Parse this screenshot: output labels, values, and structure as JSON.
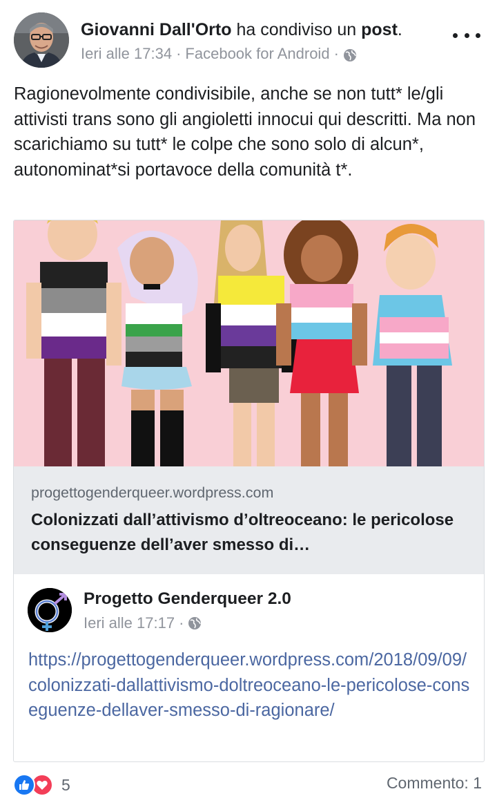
{
  "post": {
    "author": "Giovanni Dall'Orto",
    "action_text": "ha condiviso un",
    "action_object": "post",
    "action_suffix": ".",
    "timestamp": "Ieri alle 17:34",
    "source": "Facebook for Android",
    "separator": "·",
    "body": "Ragionevolmente condivisibile, anche se non tutt* le/gli attivisti trans sono gli angioletti innocui qui descritti. Ma non scarichiamo su tutt* le colpe che sono solo di alcun*, autonominat*si portavoce della comunità t*."
  },
  "link_preview": {
    "domain": "progettogenderqueer.wordpress.com",
    "title": "Colonizzati dall’attivismo d’oltreoceano: le pericolose conseguenze dell’aver smesso di…"
  },
  "shared_post": {
    "page_name": "Progetto Genderqueer 2.0",
    "timestamp": "Ieri alle 17:17",
    "separator": "·",
    "url_text": "https://progettogenderqueer.wordpress.com/2018/09/09/colonizzati-dallattivismo-doltreoceano-le-pericolose-conseguenze-dellaver-smesso-di-ragionare/"
  },
  "footer": {
    "reaction_count": "5",
    "comments_label": "Commento: 1"
  },
  "icons": {
    "more": "more-options-icon",
    "audience": "globe-icon",
    "like": "like-reaction-icon",
    "love": "love-reaction-icon"
  },
  "colors": {
    "link": "#4b67a1",
    "meta": "#90949c",
    "like": "#1877f2",
    "love": "#f33e58",
    "preview_bg": "#e9ebee",
    "image_bg": "#f9cfd6"
  }
}
